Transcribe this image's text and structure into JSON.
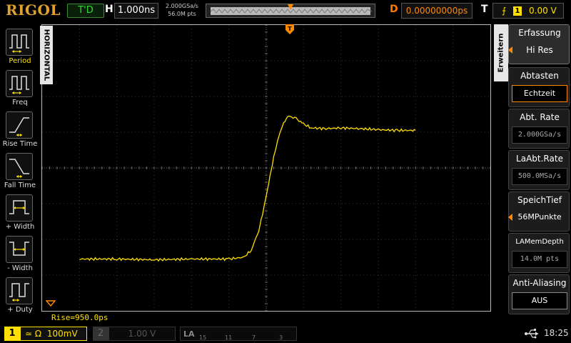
{
  "header": {
    "brand": "RIGOL",
    "run_state": "T'D",
    "timebase_letter": "H",
    "timebase": "1.000ns",
    "sample_rate": "2.000GSa/s",
    "memory_depth": "56.0M pts",
    "delay_letter": "D",
    "delay": "0.00000000ps",
    "trigger_letter": "T",
    "trigger_source": "1",
    "trigger_level": "0.00 V",
    "trigger_edge_icon": "rising-edge-icon"
  },
  "left_panel": {
    "tab": "HORIZONTAL",
    "items": [
      {
        "label": "Period",
        "icon": "period-icon"
      },
      {
        "label": "Freq",
        "icon": "frequency-icon"
      },
      {
        "label": "Rise Time",
        "icon": "rise-time-icon"
      },
      {
        "label": "Fall Time",
        "icon": "fall-time-icon"
      },
      {
        "label": "+ Width",
        "icon": "positive-width-icon"
      },
      {
        "label": "- Width",
        "icon": "negative-width-icon"
      },
      {
        "label": "+ Duty",
        "icon": "positive-duty-icon"
      }
    ]
  },
  "right_menu": {
    "tab": "Erweitern",
    "items": [
      {
        "label": "Erfassung",
        "value": "Hi Res"
      },
      {
        "label": "Abtasten",
        "value": "Echtzeit"
      },
      {
        "label": "Abt. Rate",
        "value": "2.000GSa/s"
      },
      {
        "label": "LaAbt.Rate",
        "value": "500.0MSa/s"
      },
      {
        "label": "SpeichTief",
        "value": "56MPunkte"
      },
      {
        "label": "LAMemDepth",
        "value": "14.0M pts"
      },
      {
        "label": "Anti-Aliasing",
        "value": "AUS"
      }
    ]
  },
  "measurement": {
    "readout": "Rise=950.0ps"
  },
  "footer": {
    "ch1_number": "1",
    "ch1_coupling": "≃ Ω",
    "ch1_scale": "100mV",
    "ch2_number": "2",
    "ch2_scale": "1.00 V",
    "la_label": "LA",
    "la_numbers": [
      "15",
      "11",
      "7",
      "3"
    ],
    "time": "18:25"
  },
  "colors": {
    "ch1": "#ffe000",
    "accent": "#ff8a00",
    "brand": "#e0a030",
    "run": "#33dd33"
  },
  "waveform": {
    "units": "time in ns relative to trigger, amplitude in mV",
    "points": [
      [
        -5.0,
        -255
      ],
      [
        -4.0,
        -255
      ],
      [
        -3.0,
        -257
      ],
      [
        -2.0,
        -255
      ],
      [
        -1.0,
        -255
      ],
      [
        -0.6,
        -250
      ],
      [
        -0.4,
        -230
      ],
      [
        -0.2,
        -175
      ],
      [
        -0.1,
        -130
      ],
      [
        0.0,
        -80
      ],
      [
        0.1,
        -25
      ],
      [
        0.2,
        30
      ],
      [
        0.3,
        75
      ],
      [
        0.4,
        110
      ],
      [
        0.5,
        132
      ],
      [
        0.6,
        145
      ],
      [
        0.8,
        138
      ],
      [
        1.0,
        123
      ],
      [
        1.2,
        112
      ],
      [
        1.6,
        110
      ],
      [
        2.0,
        112
      ],
      [
        2.5,
        110
      ],
      [
        3.0,
        107
      ],
      [
        3.5,
        105
      ],
      [
        4.0,
        105
      ]
    ]
  }
}
